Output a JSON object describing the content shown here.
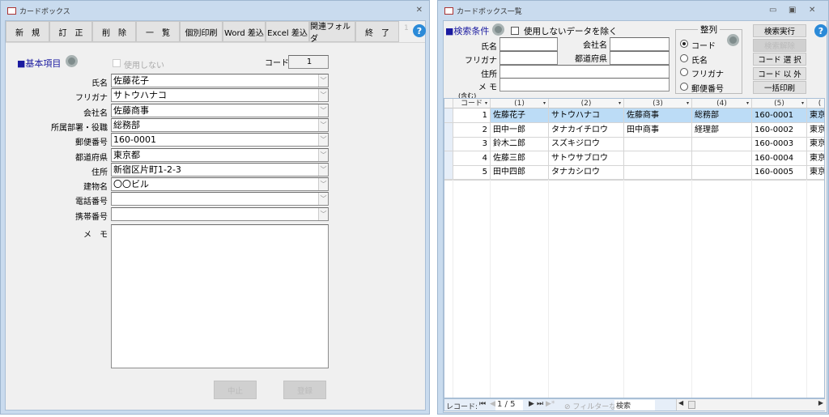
{
  "left_window": {
    "title": "カードボックス",
    "toolbar": [
      "新　規",
      "訂　正",
      "削　除",
      "一　覧",
      "個別印刷",
      "Word 差込",
      "Excel 差込",
      "関連フォルダ",
      "終　了"
    ],
    "toolbar_extra": "1",
    "section": "■基本項目",
    "unused_label": "使用しない",
    "code_label": "コード",
    "code_value": "1",
    "fields": [
      {
        "label": "氏名",
        "value": "佐藤花子"
      },
      {
        "label": "フリガナ",
        "value": "サトウハナコ"
      },
      {
        "label": "会社名",
        "value": "佐藤商事"
      },
      {
        "label": "所属部署・役職",
        "value": "総務部"
      },
      {
        "label": "郵便番号",
        "value": "160-0001"
      },
      {
        "label": "都道府県",
        "value": "東京都"
      },
      {
        "label": "住所",
        "value": "新宿区片町1-2-3"
      },
      {
        "label": "建物名",
        "value": "〇〇ビル"
      },
      {
        "label": "電話番号",
        "value": ""
      },
      {
        "label": "携帯番号",
        "value": ""
      }
    ],
    "memo_label": "メ　モ",
    "memo_value": "",
    "cancel": "中止",
    "register": "登録"
  },
  "right_window": {
    "title": "カードボックス一覧",
    "section": "■検索条件",
    "exclude_label": "使用しないデータを除く",
    "search": {
      "name": "氏名",
      "kana": "フリガナ",
      "company": "会社名",
      "pref": "都道府県",
      "address": "住所",
      "memo": "メ モ",
      "memo_note": "(含む)"
    },
    "sort": {
      "title": "整列",
      "options": [
        "コード",
        "氏名",
        "フリガナ",
        "郵便番号"
      ],
      "selected": 0
    },
    "buttons": [
      "検索実行",
      "検索解除",
      "コード 選 択",
      "コード 以 外",
      "一括印刷"
    ],
    "grid": {
      "headers": [
        "コード",
        "(1)",
        "(2)",
        "(3)",
        "(4)",
        "(5)",
        "("
      ],
      "rows": [
        [
          "1",
          "佐藤花子",
          "サトウハナコ",
          "佐藤商事",
          "総務部",
          "160-0001",
          "東京"
        ],
        [
          "2",
          "田中一郎",
          "タナカイチロウ",
          "田中商事",
          "経理部",
          "160-0002",
          "東京"
        ],
        [
          "3",
          "鈴木二郎",
          "スズキジロウ",
          "",
          "",
          "160-0003",
          "東京"
        ],
        [
          "4",
          "佐藤三郎",
          "サトウサブロウ",
          "",
          "",
          "160-0004",
          "東京"
        ],
        [
          "5",
          "田中四郎",
          "タナカシロウ",
          "",
          "",
          "160-0005",
          "東京"
        ]
      ]
    },
    "nav": {
      "record_label": "レコード:",
      "position": "1 / 5",
      "filter": "フィルターなし",
      "search": "検索"
    }
  }
}
